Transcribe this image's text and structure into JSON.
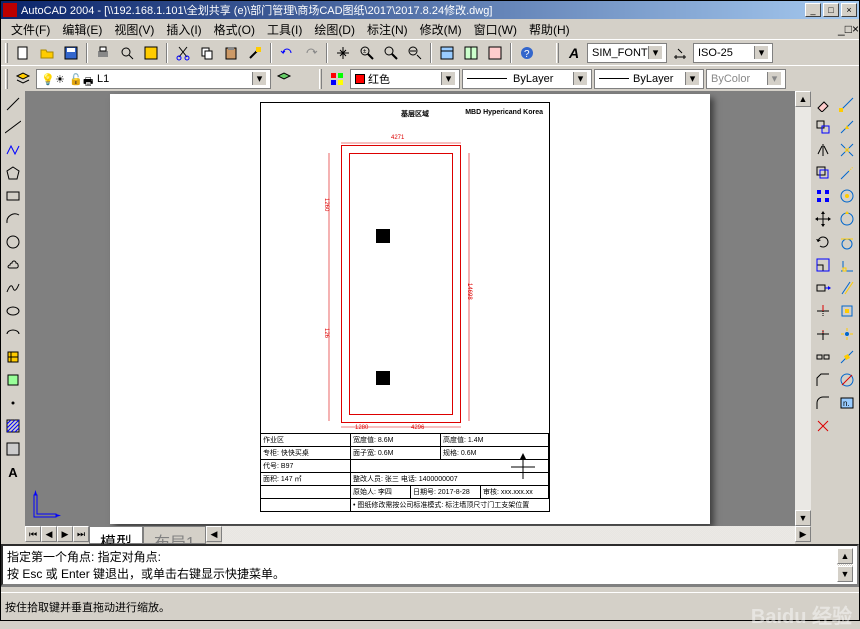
{
  "app": {
    "title": "AutoCAD 2004 - [\\\\192.168.1.101\\全划共享 (e)\\部门管理\\商场CAD图纸\\2017\\2017.8.24修改.dwg]"
  },
  "window_controls": {
    "min": "_",
    "max": "□",
    "close": "×"
  },
  "menu": {
    "file": "文件(F)",
    "edit": "编辑(E)",
    "view": "视图(V)",
    "insert": "插入(I)",
    "format": "格式(O)",
    "tools": "工具(I)",
    "draw": "绘图(D)",
    "dimension": "标注(N)",
    "modify": "修改(M)",
    "window": "窗口(W)",
    "help": "帮助(H)"
  },
  "toolbar1": {
    "font_style": "SIM_FONT",
    "dim_style": "ISO-25",
    "A_label": "A"
  },
  "layer_row": {
    "layer_name": "L1",
    "color_name": "红色",
    "linetype": "ByLayer",
    "lineweight": "ByLayer",
    "plotstyle": "ByColor"
  },
  "tabs": {
    "model": "模型",
    "layout1": "布局1"
  },
  "command": {
    "line1": "指定第一个角点: 指定对角点:",
    "line2": "按 Esc 或 Enter 键退出，或单击右键显示快捷菜单。"
  },
  "status": {
    "text": "按住拾取键并垂直拖动进行缩放。"
  },
  "drawing": {
    "header_right": "MBD Hypericand Korea",
    "header_left": "基层区域",
    "dims": {
      "top": "4271",
      "left1": "1260",
      "left2": "126",
      "bottom1": "1280",
      "bottom2": "4296",
      "right": "14698"
    },
    "titleblock": {
      "r1c1_label": "作业区",
      "r1c2_label": "宽度值:",
      "r1c2_val": "8.6M",
      "r1c3_label": "高度值:",
      "r1c3_val": "1.4M",
      "r2c1_label": "专柜:",
      "r2c1_val": "快快买桌",
      "r2c2_label": "面子宽:",
      "r2c2_val": "0.6M",
      "r2c3_label": "规格:",
      "r2c3_val": "0.6M",
      "r3c1_label": "代号:",
      "r3c1_val": "B97",
      "r4c1_label": "面积:",
      "r4c1_val": "147 ㎡",
      "r4c2": "整改人员: 张三   电话: 1400000007",
      "r5a": "原始人: 李四",
      "r5b": "日期号: 2017-8-28",
      "r5c": "审核: xxx.xxx.xx",
      "r6": "• 图纸修改需按公司标准模式: 标注墙顶尺寸门工支架位置"
    }
  },
  "watermark": "Baidu 经验",
  "arrows": {
    "left": "◀",
    "right": "▶",
    "up": "▲",
    "down": "▼"
  }
}
